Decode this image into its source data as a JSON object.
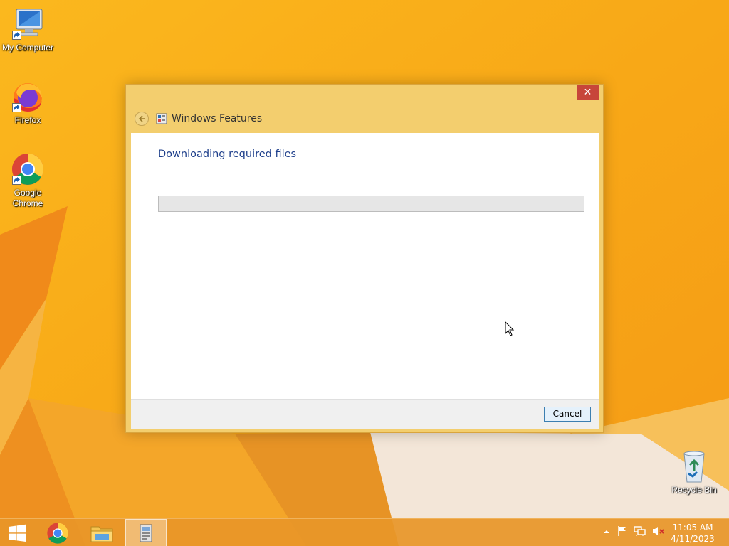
{
  "desktop": {
    "icons": [
      {
        "label": "My Computer",
        "icon": "computer-icon"
      },
      {
        "label": "Firefox",
        "icon": "firefox-icon"
      },
      {
        "label": "Google Chrome",
        "icon": "chrome-icon"
      },
      {
        "label": "Recycle Bin",
        "icon": "recycle-bin-icon"
      }
    ]
  },
  "dialog": {
    "title": "Windows Features",
    "heading": "Downloading required files",
    "progress": 0,
    "cancel_label": "Cancel",
    "close_symbol": "✕"
  },
  "taskbar": {
    "apps": [
      {
        "name": "chrome",
        "icon": "chrome-icon",
        "active": false
      },
      {
        "name": "file-explorer",
        "icon": "folder-icon",
        "active": false
      },
      {
        "name": "windows-features",
        "icon": "windows-features-icon",
        "active": true
      }
    ],
    "tray_icons": [
      "show-hidden-icons-icon",
      "action-center-flag-icon",
      "network-icon",
      "volume-muted-icon"
    ],
    "clock": {
      "time": "11:05 AM",
      "date": "4/11/2023"
    }
  },
  "colors": {
    "accent": "#f3ce6e",
    "heading": "#1e3f8b",
    "close": "#c7463a",
    "wallpaper": "#f7a71a"
  }
}
